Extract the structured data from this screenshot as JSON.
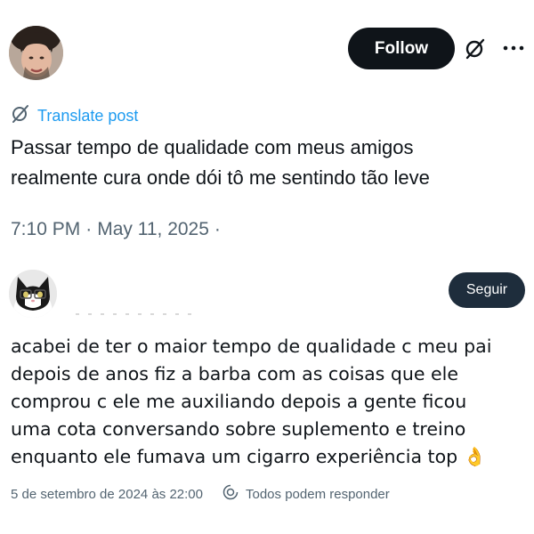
{
  "post": {
    "follow_label": "Follow",
    "translate_label": "Translate post",
    "text_line1": "Passar tempo de qualidade com meus amigos",
    "text_line2": "realmente cura onde dói tô me sentindo tão leve",
    "time": "7:10 PM",
    "date": "May 11, 2025",
    "dot": "·",
    "trailing_dot": "·",
    "icons": {
      "grok": "grok-icon",
      "more": "more-dots-icon",
      "translate": "translate-icon"
    }
  },
  "reply": {
    "follow_label": "Seguir",
    "lines": [
      "acabei de ter o maior tempo de qualidade c meu pai",
      "depois de anos fiz a barba com as coisas que ele",
      "comprou c ele me auxiliando depois a gente ficou",
      "uma cota conversando sobre suplemento e treino",
      "enquanto ele fumava um cigarro experiência top"
    ],
    "emoji": "👌",
    "timestamp": "5 de setembro de 2024 às 22:00",
    "reply_setting": "Todos podem responder",
    "icons": {
      "reply_setting": "reply-permission-icon"
    }
  },
  "colors": {
    "link": "#1d9bf0",
    "meta": "#536471",
    "text": "#0f1419",
    "button_dark": "#0f1419",
    "seguir_bg": "#1e2d3c"
  }
}
